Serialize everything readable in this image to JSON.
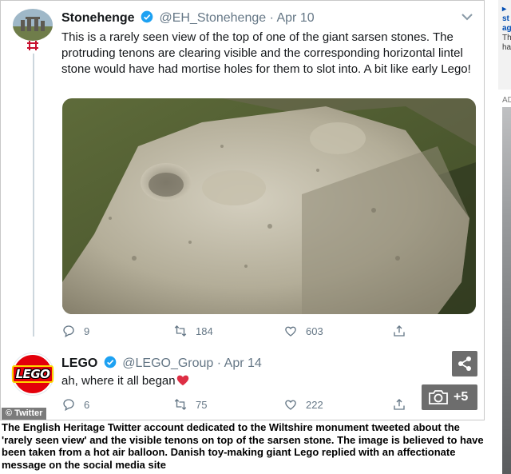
{
  "tweet1": {
    "name": "Stonehenge",
    "handle": "@EH_Stonehenge",
    "separator": "·",
    "date": "Apr 10",
    "text": "This is a rarely seen view of the top of one of the giant sarsen stones. The protruding tenons are clearing visible and the corresponding horizontal lintel stone would have had mortise holes for them to slot into. A bit like early Lego!",
    "replies": "9",
    "retweets": "184",
    "likes": "603"
  },
  "tweet2": {
    "name": "LEGO",
    "handle": "@LEGO_Group",
    "separator": "·",
    "date": "Apr 14",
    "text": "ah, where it all began",
    "avatar_text": "LEGO",
    "replies": "6",
    "retweets": "75",
    "likes": "222"
  },
  "overlay": {
    "photo_count": "+5",
    "credit": "© Twitter"
  },
  "caption": "The English Heritage Twitter account dedicated to the Wiltshire monument tweeted about the 'rarely seen view' and the visible tenons on top of the sarsen stone. The image is believed to have been taken from a hot air balloon. Danish toy-making giant Lego replied with an affectionate message on the social media site",
  "right_column": {
    "line1": "▸",
    "line2": "st",
    "line3": "ag",
    "line4": "Th",
    "line5": "ha",
    "ad_label": "ADV"
  },
  "colors": {
    "twitter_blue": "#1da1f2",
    "muted_gray": "#657786",
    "lego_red": "#e3000b",
    "heart_red": "#e0245e"
  },
  "icons": [
    "verified-badge-icon",
    "chevron-down-icon",
    "reply-icon",
    "retweet-icon",
    "like-icon",
    "share-icon",
    "camera-icon",
    "heart-emoji-icon",
    "english-heritage-flag-icon"
  ]
}
